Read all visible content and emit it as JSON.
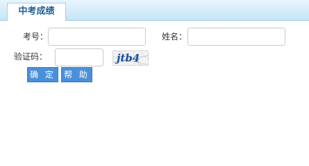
{
  "header": {
    "tab_label": "中考成绩"
  },
  "form": {
    "exam_number_label": "考号：",
    "exam_number_value": "",
    "name_label": "姓名：",
    "name_value": "",
    "captcha_label": "验证码：",
    "captcha_value": "",
    "captcha_image_text": "jtb4"
  },
  "buttons": {
    "confirm_label": "确 定",
    "help_label": "帮 助"
  },
  "colors": {
    "tab_text": "#1d5f93",
    "header_bg": "#c6e4f6",
    "button_bg": "#4a90d9"
  }
}
